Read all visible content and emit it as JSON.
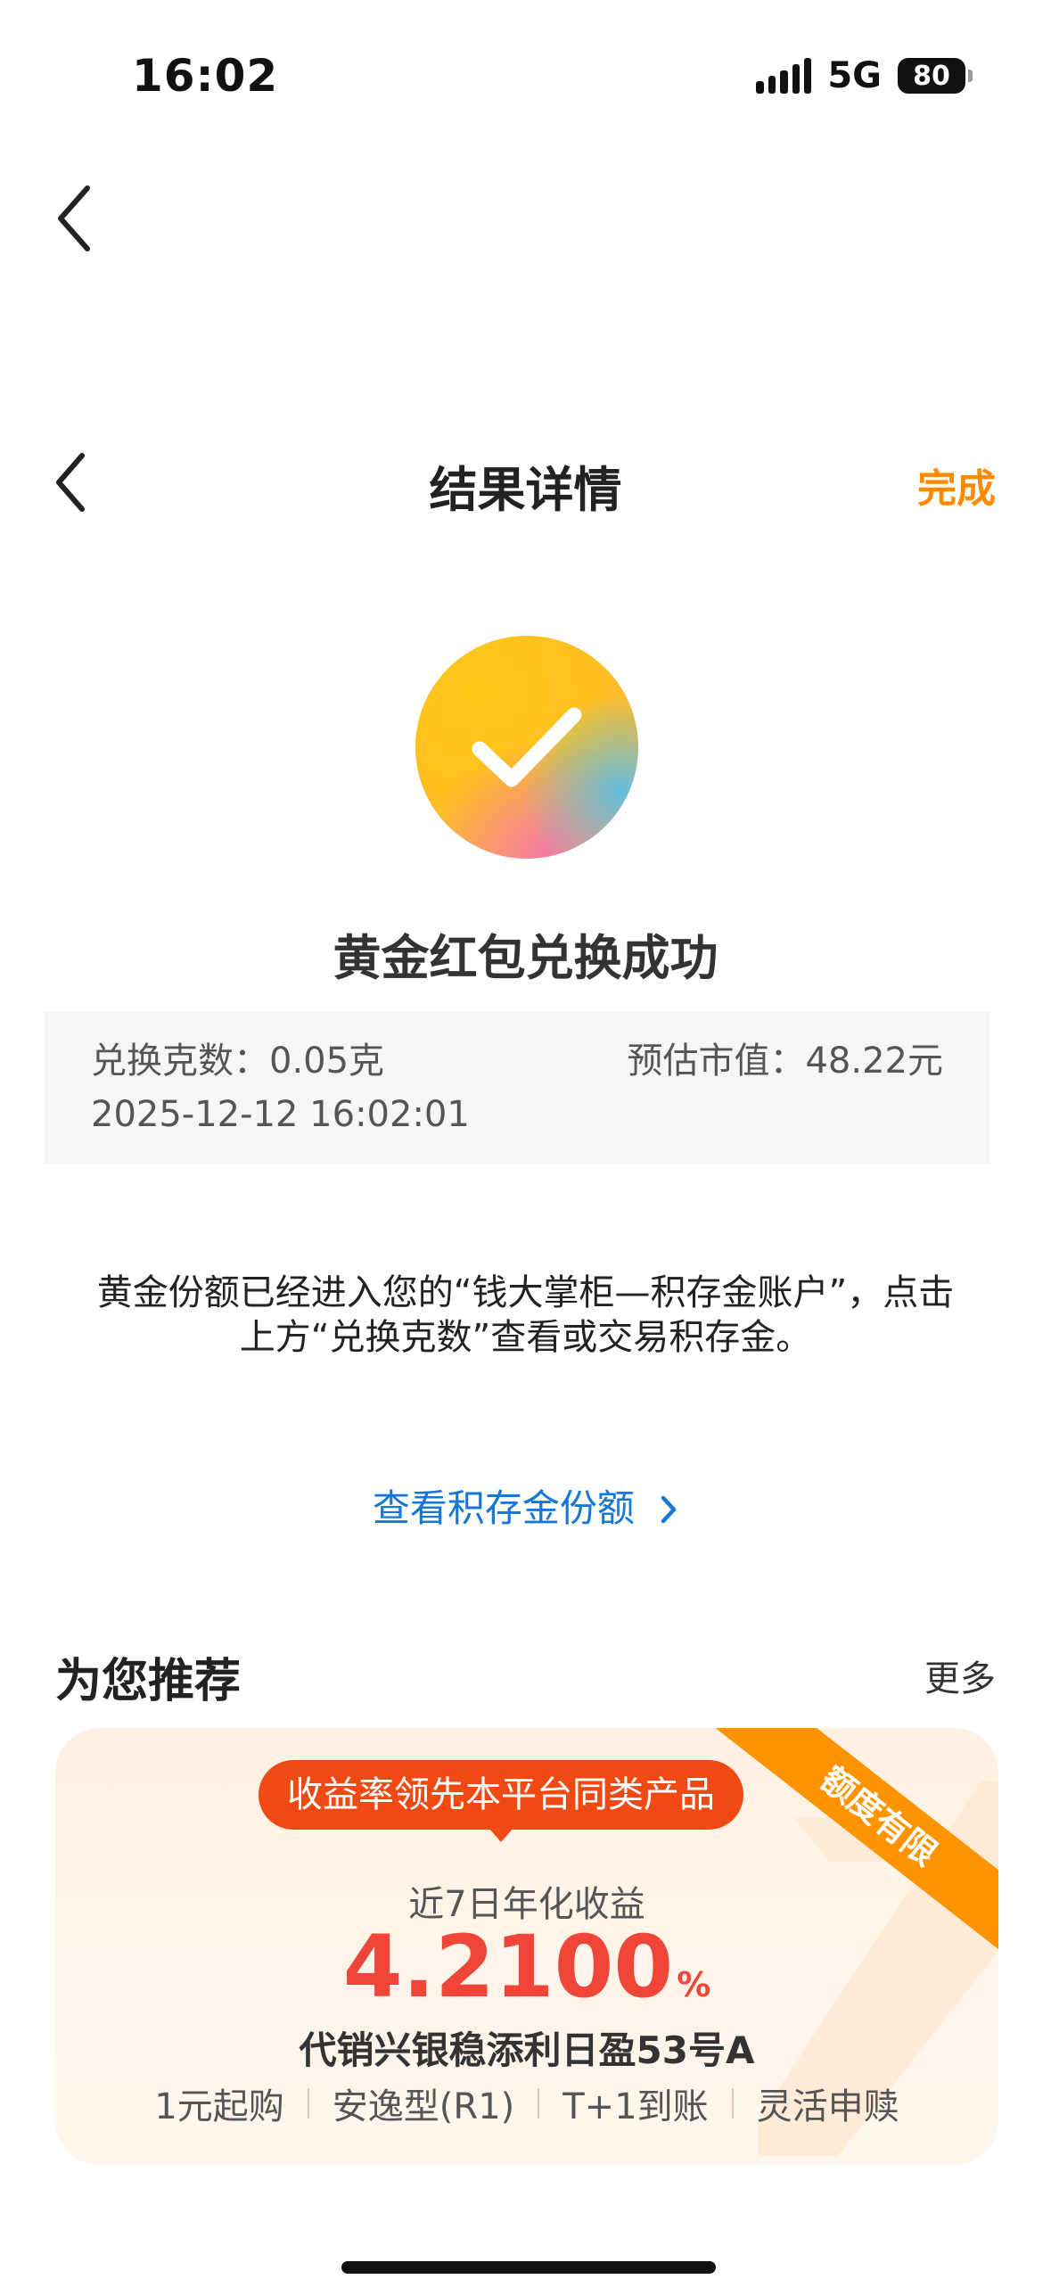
{
  "status_bar": {
    "time": "16:02",
    "network": "5G",
    "battery": "80"
  },
  "nav": {
    "title": "结果详情",
    "done_label": "完成"
  },
  "result": {
    "title": "黄金红包兑换成功",
    "grams": "兑换克数：0.05克",
    "market_value": "预估市值：48.22元",
    "time": "2025-12-12 16:02:01"
  },
  "description": {
    "line1": "黄金份额已经进入您的“钱大掌柜—积存金账户”，点击",
    "line2": "上方“兑换克数”查看或交易积存金。"
  },
  "view_link": {
    "label": "查看积存金份额"
  },
  "recommend": {
    "title": "为您推荐",
    "more_label": "更多",
    "card": {
      "ribbon": "额度有限",
      "pill": "收益率领先本平台同类产品",
      "yield_label": "近7日年化收益",
      "yield_value": "4.2100",
      "yield_unit": "%",
      "product_name": "代销兴银稳添利日盈53号A",
      "features": [
        "1元起购",
        "安逸型(R1)",
        "T+1到账",
        "灵活申赎"
      ]
    }
  },
  "colors": {
    "accent": "#ff8a00",
    "link": "#1677d6",
    "yield": "#f0463a",
    "pill": "#f04a14",
    "ribbon": "#ff9300"
  }
}
